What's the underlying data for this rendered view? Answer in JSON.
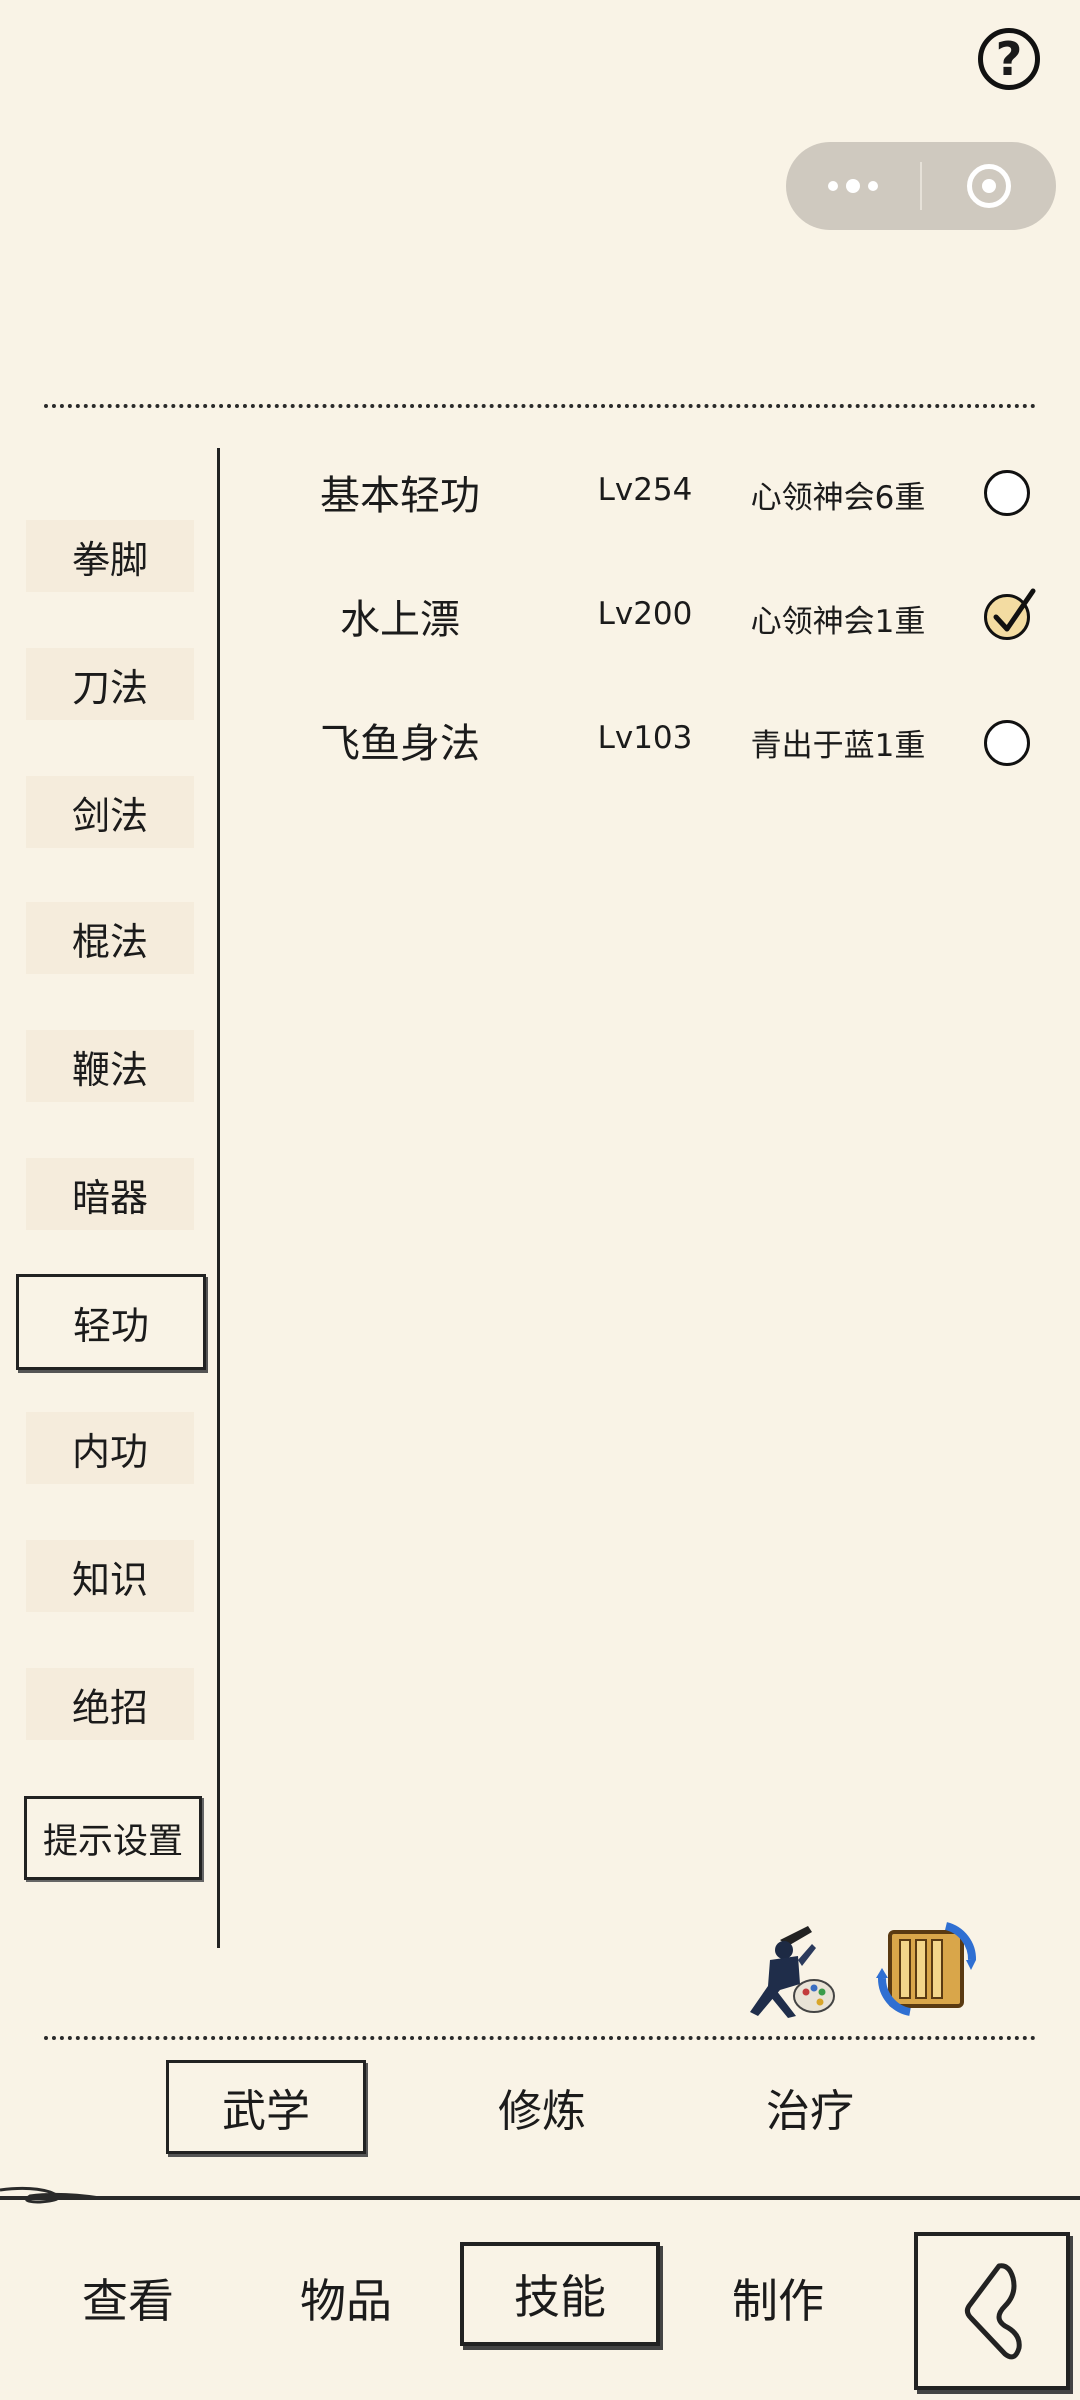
{
  "header": {
    "help_icon": "question-mark-icon",
    "capsule": {
      "more_icon": "more-dots-icon",
      "close_icon": "target-circle-icon"
    }
  },
  "sidebar": {
    "items": [
      {
        "label": "拳脚",
        "active": false
      },
      {
        "label": "刀法",
        "active": false
      },
      {
        "label": "剑法",
        "active": false
      },
      {
        "label": "棍法",
        "active": false
      },
      {
        "label": "鞭法",
        "active": false
      },
      {
        "label": "暗器",
        "active": false
      },
      {
        "label": "轻功",
        "active": true
      },
      {
        "label": "内功",
        "active": false
      },
      {
        "label": "知识",
        "active": false
      },
      {
        "label": "绝招",
        "active": false
      }
    ],
    "hint_settings": "提示设置"
  },
  "skills": [
    {
      "name": "基本轻功",
      "level": "Lv254",
      "stage": "心领神会6重",
      "checked": false
    },
    {
      "name": "水上漂",
      "level": "Lv200",
      "stage": "心领神会1重",
      "checked": true
    },
    {
      "name": "飞鱼身法",
      "level": "Lv103",
      "stage": "青出于蓝1重",
      "checked": false
    }
  ],
  "action_icons": [
    "warrior-palette-icon",
    "scroll-swap-icon"
  ],
  "sub_tabs": [
    {
      "label": "武学",
      "active": true
    },
    {
      "label": "修炼",
      "active": false
    },
    {
      "label": "治疗",
      "active": false
    }
  ],
  "bottom_nav": [
    {
      "label": "查看",
      "active": false
    },
    {
      "label": "物品",
      "active": false
    },
    {
      "label": "技能",
      "active": true
    },
    {
      "label": "制作",
      "active": false
    }
  ],
  "back_icon": "back-arrow-icon",
  "colors": {
    "background": "#f9f3e6",
    "ink": "#1b1b1b",
    "check_fill": "#f3dca2",
    "capsule": "#cfc9bf"
  }
}
